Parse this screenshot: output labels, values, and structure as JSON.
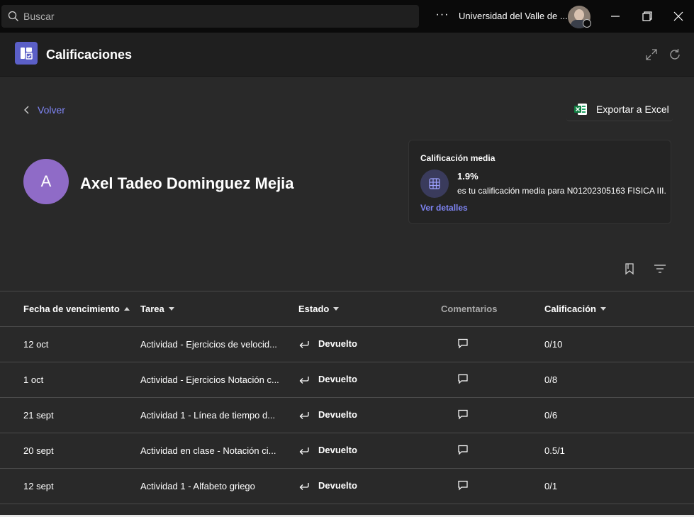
{
  "titlebar": {
    "search_placeholder": "Buscar",
    "more_label": "···",
    "org_name": "Universidad del Valle de ..."
  },
  "app": {
    "title": "Calificaciones",
    "accent": "#5b5fc7"
  },
  "nav": {
    "back_label": "Volver",
    "export_label": "Exportar a Excel"
  },
  "student": {
    "initial": "A",
    "name": "Axel Tadeo Dominguez Mejia"
  },
  "average_card": {
    "title": "Calificación media",
    "value": "1.9%",
    "description": "es tu calificación media para N01202305163 FISICA III.",
    "link": "Ver detalles"
  },
  "table": {
    "headers": {
      "due_date": "Fecha de vencimiento",
      "task": "Tarea",
      "status": "Estado",
      "comments": "Comentarios",
      "grade": "Calificación"
    },
    "rows": [
      {
        "date": "12 oct",
        "task": "Actividad - Ejercicios de velocid...",
        "status": "Devuelto",
        "grade": "0/10"
      },
      {
        "date": "1 oct",
        "task": "Actividad - Ejercicios Notación c...",
        "status": "Devuelto",
        "grade": "0/8"
      },
      {
        "date": "21 sept",
        "task": "Actividad 1 - Línea de tiempo d...",
        "status": "Devuelto",
        "grade": "0/6"
      },
      {
        "date": "20 sept",
        "task": "Actividad en clase - Notación ci...",
        "status": "Devuelto",
        "grade": "0.5/1"
      },
      {
        "date": "12 sept",
        "task": "Actividad 1 - Alfabeto griego",
        "status": "Devuelto",
        "grade": "0/1"
      }
    ]
  }
}
